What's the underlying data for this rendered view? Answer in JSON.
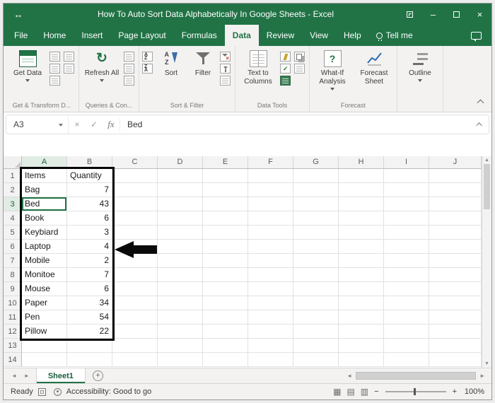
{
  "window": {
    "title": "How To Auto Sort Data Alphabetically In Google Sheets - Excel"
  },
  "menu": {
    "tabs": [
      "File",
      "Home",
      "Insert",
      "Page Layout",
      "Formulas",
      "Data",
      "Review",
      "View",
      "Help"
    ],
    "active_tab": "Data",
    "tell_me": "Tell me"
  },
  "ribbon": {
    "group_labels": [
      "Get & Transform D...",
      "Queries & Con...",
      "Sort & Filter",
      "Data Tools",
      "Forecast",
      ""
    ],
    "buttons": {
      "get_data": "Get Data",
      "refresh_all": "Refresh All",
      "sort": "Sort",
      "filter": "Filter",
      "text_to_columns": "Text to Columns",
      "what_if_analysis": "What-If Analysis",
      "forecast_sheet": "Forecast Sheet",
      "outline": "Outline"
    }
  },
  "formula_bar": {
    "name_box": "A3",
    "fx": "fx",
    "value": "Bed"
  },
  "grid": {
    "col_headers": [
      "A",
      "B",
      "C",
      "D",
      "E",
      "F",
      "G",
      "H",
      "I",
      "J"
    ],
    "row_count": 14,
    "selected_cell": "A3",
    "selected_col": "A",
    "selected_row": 3,
    "cells": [
      [
        "Items",
        "Quantity"
      ],
      [
        "Bag",
        "7"
      ],
      [
        "Bed",
        "43"
      ],
      [
        "Book",
        "6"
      ],
      [
        "Keybiard",
        "3"
      ],
      [
        "Laptop",
        "4"
      ],
      [
        "Mobile",
        "2"
      ],
      [
        "Monitoe",
        "7"
      ],
      [
        "Mouse",
        "6"
      ],
      [
        "Paper",
        "34"
      ],
      [
        "Pen",
        "54"
      ],
      [
        "Pillow",
        "22"
      ]
    ]
  },
  "sheets": {
    "tabs": [
      "Sheet1"
    ]
  },
  "status": {
    "mode": "Ready",
    "accessibility": "Accessibility: Good to go",
    "zoom": "100%"
  },
  "icons": {
    "quick_access": "↔",
    "minimize": "–",
    "close": "×",
    "refresh": "↻",
    "cancel": "×",
    "enter": "✓",
    "nav_left": "◄",
    "nav_right": "►",
    "add_sheet": "+",
    "scroll_up": "▲",
    "scroll_down": "▼",
    "scroll_left": "◄",
    "scroll_right": "►",
    "zoom_out": "−",
    "zoom_in": "+",
    "view_normal": "▦",
    "view_page_layout": "▤",
    "view_page_break": "▥"
  }
}
